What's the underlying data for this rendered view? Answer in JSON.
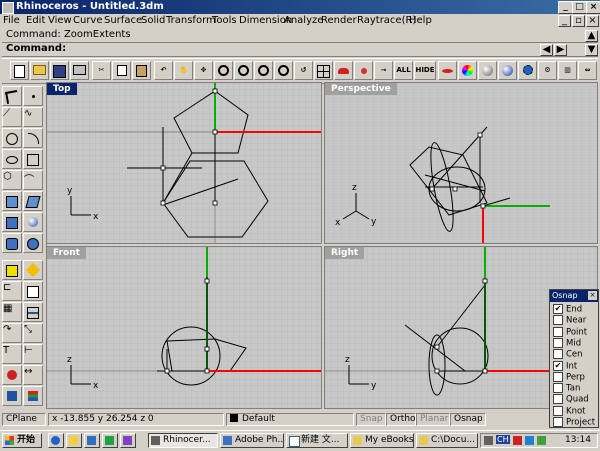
{
  "window": {
    "title": "Rhinoceros - Untitled.3dm",
    "min": "_",
    "max": "□",
    "close": "×"
  },
  "menu": [
    "File",
    "Edit",
    "View",
    "Curve",
    "Surface",
    "Solid",
    "Transform",
    "Tools",
    "Dimension",
    "Analyze",
    "Render",
    "Raytrace(R)",
    "Help"
  ],
  "command": {
    "history": "Command: ZoomExtents",
    "prompt": "Command:"
  },
  "toolbar": {
    "all_label": "ALL",
    "hide_label": "HIDE"
  },
  "viewports": {
    "top": "Top",
    "perspective": "Perspective",
    "front": "Front",
    "right": "Right"
  },
  "axes": {
    "x": "x",
    "y": "y",
    "z": "z"
  },
  "status": {
    "cplane": "CPlane",
    "coords": "x -13.855  y 26.254  z 0",
    "layer": "Default",
    "snap": "Snap",
    "ortho": "Ortho",
    "planar": "Planar",
    "osnap": "Osnap"
  },
  "osnap": {
    "title": "Osnap",
    "items": [
      {
        "label": "End",
        "checked": true
      },
      {
        "label": "Near",
        "checked": false
      },
      {
        "label": "Point",
        "checked": false
      },
      {
        "label": "Mid",
        "checked": false
      },
      {
        "label": "Cen",
        "checked": false
      },
      {
        "label": "Int",
        "checked": true
      },
      {
        "label": "Perp",
        "checked": false
      },
      {
        "label": "Tan",
        "checked": false
      },
      {
        "label": "Quad",
        "checked": false
      },
      {
        "label": "Knot",
        "checked": false
      },
      {
        "label": "Project",
        "checked": false
      }
    ]
  },
  "taskbar": {
    "start": "开始",
    "tasks": [
      "Rhinocer...",
      "Adobe Ph...",
      "新建 文...",
      "My eBooks",
      "C:\\Docu..."
    ],
    "tray_lang": "CH",
    "clock": "13:14"
  },
  "colors": {
    "title_active": "#0a246a",
    "x_axis": "#ff0000",
    "y_axis": "#00c000"
  }
}
